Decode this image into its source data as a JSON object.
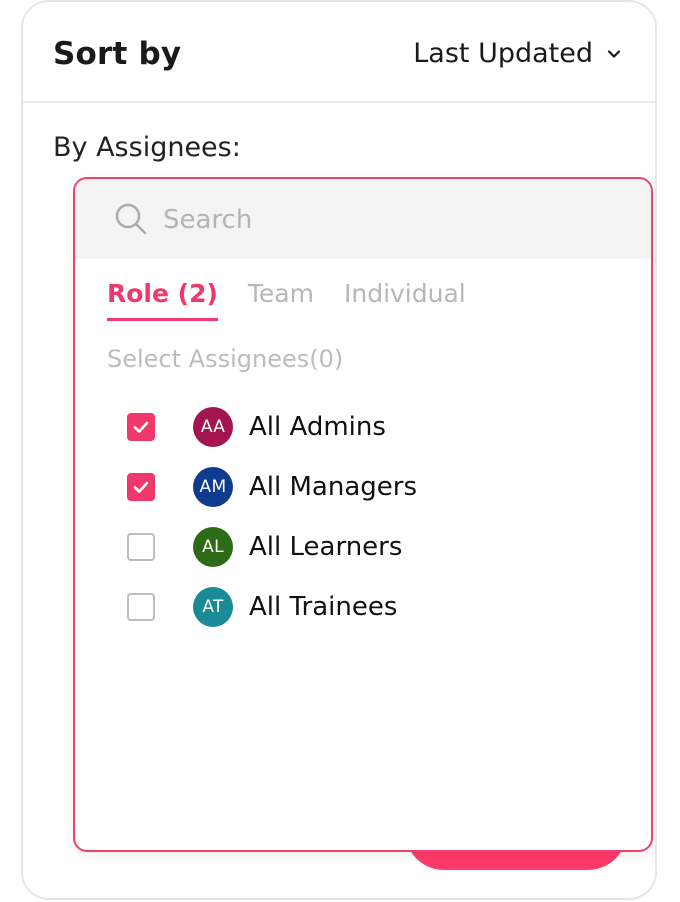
{
  "sort": {
    "label": "Sort by",
    "value": "Last Updated",
    "icon": "chevron-down-icon"
  },
  "assignees": {
    "label": "By Assignees:",
    "search_placeholder": "Search",
    "search_value": "",
    "tabs": [
      {
        "label": "Role (2)",
        "active": true
      },
      {
        "label": "Team",
        "active": false
      },
      {
        "label": "Individual",
        "active": false
      }
    ],
    "select_label": "Select Assignees(0)",
    "roles": [
      {
        "initials": "AA",
        "name": "All Admins",
        "checked": true,
        "color": "#a3154f"
      },
      {
        "initials": "AM",
        "name": "All Managers",
        "checked": true,
        "color": "#0f3b8e"
      },
      {
        "initials": "AL",
        "name": "All Learners",
        "checked": false,
        "color": "#2e6b16"
      },
      {
        "initials": "AT",
        "name": "All Trainees",
        "checked": false,
        "color": "#1a8a96"
      }
    ]
  },
  "colors": {
    "accent": "#f0386a",
    "button": "#ff3a6a"
  }
}
